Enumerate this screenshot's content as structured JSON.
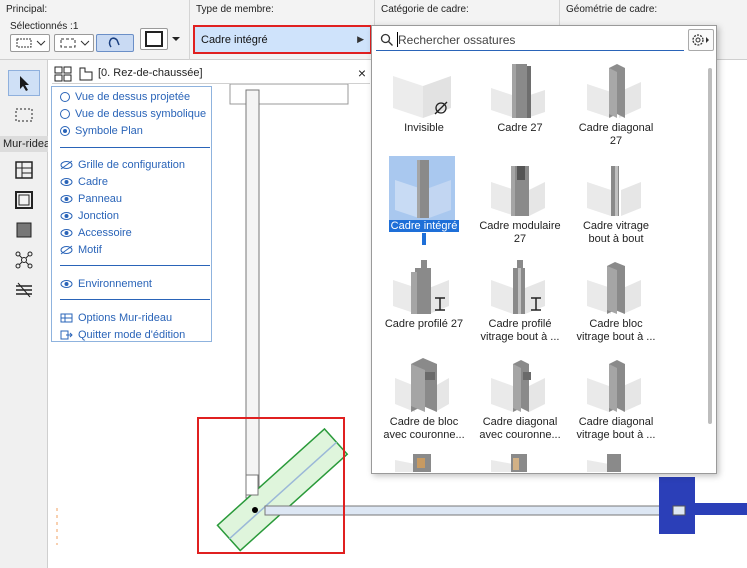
{
  "topbar": {
    "principal_label": "Principal:",
    "selected_label": "Sélectionnés :1",
    "type_label": "Type de membre:",
    "type_value": "Cadre intégré",
    "category_label": "Catégorie de cadre:",
    "geometry_label": "Géométrie de cadre:"
  },
  "toolbox": {
    "section_label": "Mur-rideau"
  },
  "floor_tab": {
    "title": "[0. Rez-de-chaussée]"
  },
  "panel": {
    "view_options": [
      {
        "label": "Vue de dessus projetée",
        "selected": false
      },
      {
        "label": "Vue de dessus symbolique",
        "selected": false
      },
      {
        "label": "Symbole Plan",
        "selected": true
      }
    ],
    "components": [
      {
        "label": "Grille de configuration",
        "visible": false
      },
      {
        "label": "Cadre",
        "visible": true
      },
      {
        "label": "Panneau",
        "visible": true
      },
      {
        "label": "Jonction",
        "visible": true
      },
      {
        "label": "Accessoire",
        "visible": true
      },
      {
        "label": "Motif",
        "visible": false
      }
    ],
    "environment": "Environnement",
    "options": "Options Mur-rideau",
    "quit": "Quitter mode d'édition"
  },
  "library": {
    "search_placeholder": "Rechercher ossatures",
    "items": [
      {
        "line1": "Invisible",
        "line2": "",
        "selected": false
      },
      {
        "line1": "Cadre 27",
        "line2": "",
        "selected": false
      },
      {
        "line1": "Cadre diagonal",
        "line2": "27",
        "selected": false
      },
      {
        "line1": "Cadre intégré",
        "line2": "",
        "selected": true
      },
      {
        "line1": "Cadre modulaire",
        "line2": "27",
        "selected": false
      },
      {
        "line1": "Cadre vitrage",
        "line2": "bout à bout",
        "selected": false
      },
      {
        "line1": "Cadre profilé 27",
        "line2": "",
        "selected": false
      },
      {
        "line1": "Cadre profilé",
        "line2": "vitrage bout à ...",
        "selected": false
      },
      {
        "line1": "Cadre bloc",
        "line2": "vitrage bout à ...",
        "selected": false
      },
      {
        "line1": "Cadre de bloc",
        "line2": "avec couronne...",
        "selected": false
      },
      {
        "line1": "Cadre diagonal",
        "line2": "avec couronne...",
        "selected": false
      },
      {
        "line1": "Cadre diagonal",
        "line2": "vitrage bout à ...",
        "selected": false
      }
    ]
  },
  "colors": {
    "accent": "#2a64b8",
    "highlight_red": "#e02020",
    "selection_blue": "#1e6fd8",
    "frame_green": "#2a9a3a",
    "wall_blue": "#2b3fb8"
  }
}
